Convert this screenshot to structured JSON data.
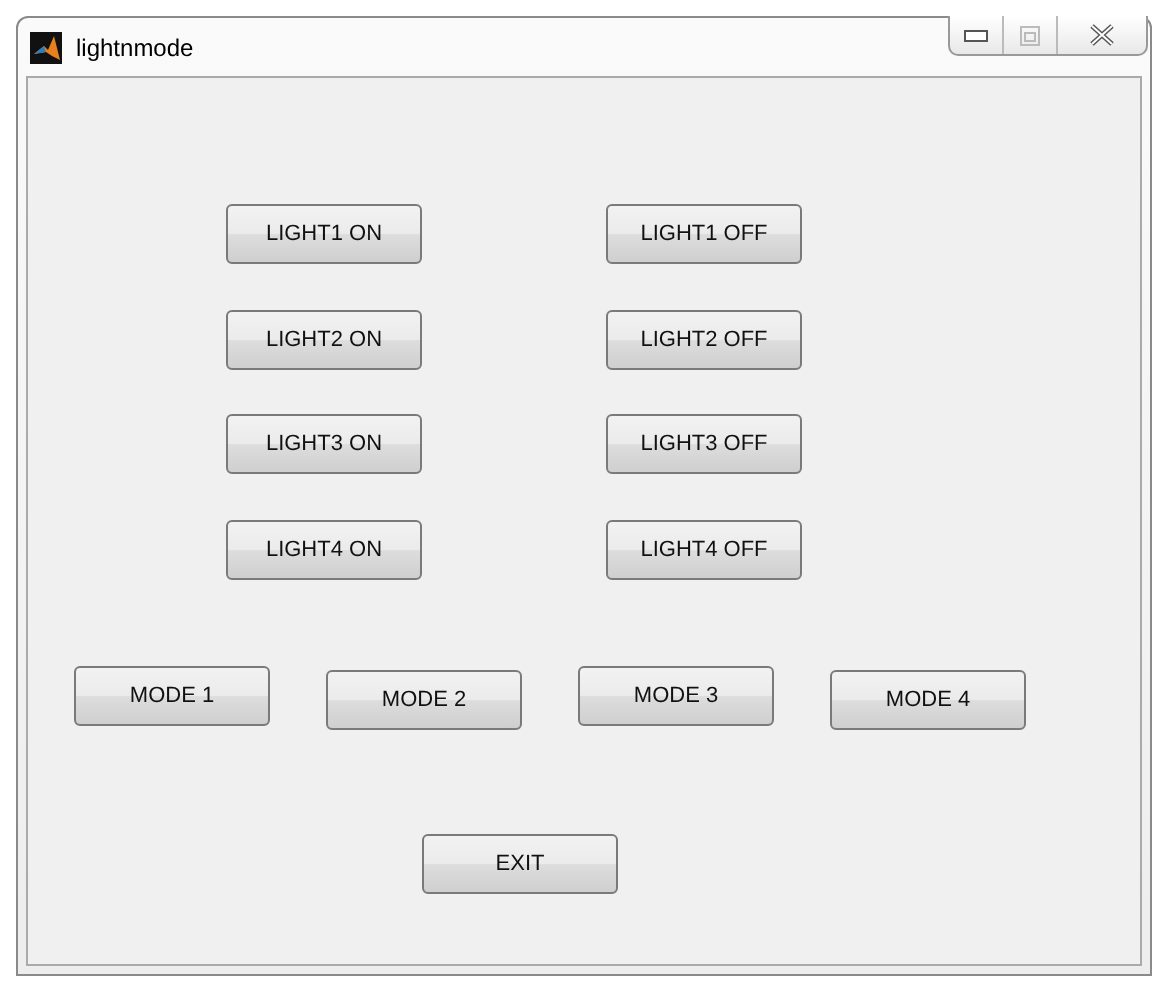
{
  "window": {
    "title": "lightnmode"
  },
  "light_buttons": [
    {
      "label": "LIGHT1 ON"
    },
    {
      "label": "LIGHT1 OFF"
    },
    {
      "label": "LIGHT2 ON"
    },
    {
      "label": "LIGHT2 OFF"
    },
    {
      "label": "LIGHT3 ON"
    },
    {
      "label": "LIGHT3 OFF"
    },
    {
      "label": "LIGHT4 ON"
    },
    {
      "label": "LIGHT4 OFF"
    }
  ],
  "mode_buttons": [
    {
      "label": "MODE 1"
    },
    {
      "label": "MODE 2"
    },
    {
      "label": "MODE 3"
    },
    {
      "label": "MODE 4"
    }
  ],
  "exit_button": {
    "label": "EXIT"
  }
}
